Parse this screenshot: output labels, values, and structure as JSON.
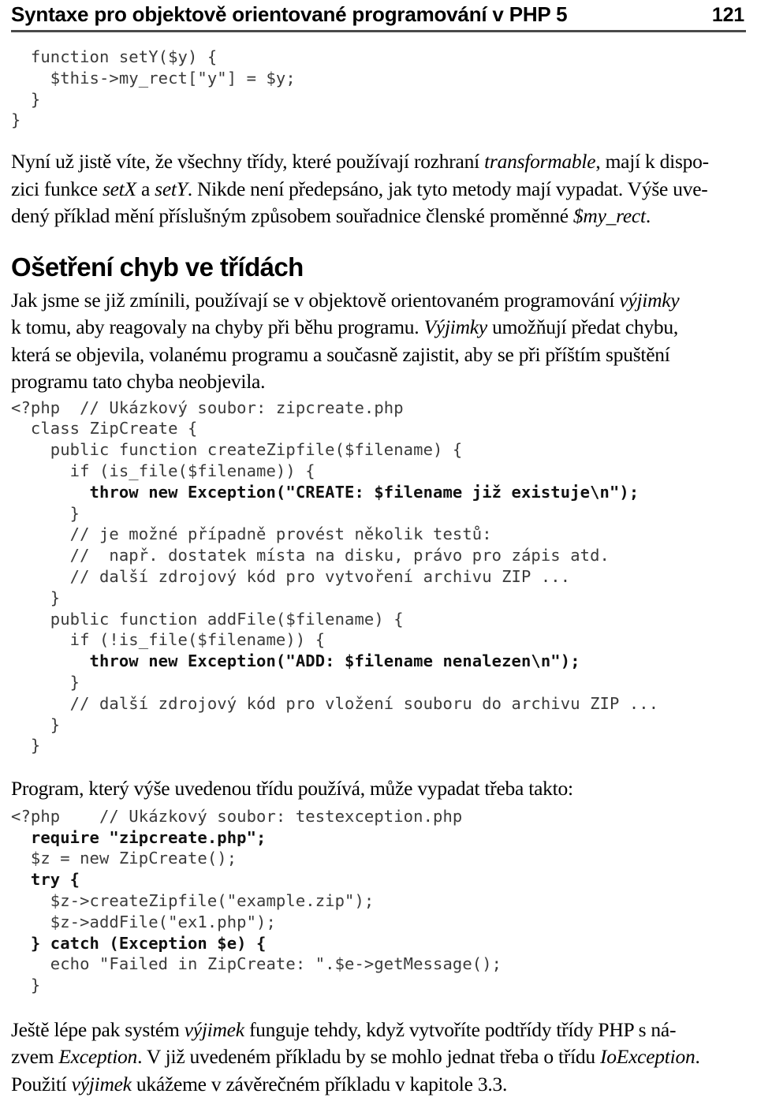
{
  "running_head": {
    "title": "Syntaxe pro objektově orientované programování v PHP 5",
    "page_number": "121"
  },
  "code_block_top": {
    "name": "setY method fragment",
    "lines": [
      "  function setY($y) {",
      "    $this->my_rect[\"y\"] = $y;",
      "  }",
      "}"
    ]
  },
  "paragraph_after_code1": {
    "lines": [
      {
        "parts": [
          {
            "t": "Nyní už jistě víte, že všechny třídy, které používají rozhraní ",
            "style": "normal"
          },
          {
            "t": "transformable",
            "style": "italic"
          },
          {
            "t": ", mají k dispo-",
            "style": "normal"
          }
        ]
      },
      {
        "parts": [
          {
            "t": "zici funkce ",
            "style": "normal"
          },
          {
            "t": "setX",
            "style": "italic"
          },
          {
            "t": " a ",
            "style": "normal"
          },
          {
            "t": "setY",
            "style": "italic"
          },
          {
            "t": ". Nikde není předepsáno, jak tyto metody mají vypadat. Výše uve-",
            "style": "normal"
          }
        ]
      },
      {
        "parts": [
          {
            "t": "dený příklad mění příslušným způsobem souřadnice členské proměnné ",
            "style": "normal"
          },
          {
            "t": "$my_rect",
            "style": "italic"
          },
          {
            "t": ".",
            "style": "normal"
          }
        ]
      }
    ]
  },
  "section_heading": "Ošetření chyb ve třídách",
  "paragraph_intro": {
    "lines": [
      {
        "parts": [
          {
            "t": "Jak jsme se již zmínili, používají se v objektově orientovaném programování ",
            "style": "normal"
          },
          {
            "t": "výjimky",
            "style": "italic"
          }
        ]
      },
      {
        "parts": [
          {
            "t": "k tomu, aby reagovaly na chyby při běhu programu. ",
            "style": "normal"
          },
          {
            "t": "Výjimky",
            "style": "italic"
          },
          {
            "t": " umožňují předat chybu,",
            "style": "normal"
          }
        ]
      },
      {
        "parts": [
          {
            "t": "která se objevila, volanému programu a současně zajistit, aby se při příštím spuštění",
            "style": "normal"
          }
        ]
      },
      {
        "parts": [
          {
            "t": "programu tato chyba neobjevila.",
            "style": "normal"
          }
        ]
      }
    ]
  },
  "code_block_zipcreate": {
    "name": "zipcreate.php",
    "lines": [
      {
        "segments": [
          {
            "t": "<?php  // Ukázkový soubor: zipcreate.php",
            "bold": false
          }
        ]
      },
      {
        "segments": [
          {
            "t": "  class ZipCreate {",
            "bold": false
          }
        ]
      },
      {
        "segments": [
          {
            "t": "    public function createZipfile($filename) {",
            "bold": false
          }
        ]
      },
      {
        "segments": [
          {
            "t": "      if (is_file($filename)) {",
            "bold": false
          }
        ]
      },
      {
        "segments": [
          {
            "t": "        throw new Exception(\"CREATE: $filename již existuje\\n\");",
            "bold": true
          }
        ]
      },
      {
        "segments": [
          {
            "t": "      }",
            "bold": false
          }
        ]
      },
      {
        "segments": [
          {
            "t": "      // je možné případně provést několik testů:",
            "bold": false
          }
        ]
      },
      {
        "segments": [
          {
            "t": "      //  např. dostatek místa na disku, právo pro zápis atd.",
            "bold": false
          }
        ]
      },
      {
        "segments": [
          {
            "t": "      // další zdrojový kód pro vytvoření archivu ZIP ...",
            "bold": false
          }
        ]
      },
      {
        "segments": [
          {
            "t": "    }",
            "bold": false
          }
        ]
      },
      {
        "segments": [
          {
            "t": "    public function addFile($filename) {",
            "bold": false
          }
        ]
      },
      {
        "segments": [
          {
            "t": "      if (!is_file($filename)) {",
            "bold": false
          }
        ]
      },
      {
        "segments": [
          {
            "t": "        throw new Exception(\"ADD: $filename nenalezen\\n\");",
            "bold": true
          }
        ]
      },
      {
        "segments": [
          {
            "t": "      }",
            "bold": false
          }
        ]
      },
      {
        "segments": [
          {
            "t": "      // další zdrojový kód pro vložení souboru do archivu ZIP ...",
            "bold": false
          }
        ]
      },
      {
        "segments": [
          {
            "t": "    }",
            "bold": false
          }
        ]
      },
      {
        "segments": [
          {
            "t": "  }",
            "bold": false
          }
        ]
      }
    ]
  },
  "paragraph_program": {
    "lines": [
      {
        "parts": [
          {
            "t": "Program, který výše uvedenou třídu používá, může vypadat třeba takto:",
            "style": "normal"
          }
        ]
      }
    ]
  },
  "code_block_testexception": {
    "name": "testexception.php",
    "lines": [
      {
        "segments": [
          {
            "t": "<?php    // Ukázkový soubor: testexception.php",
            "bold": false
          }
        ]
      },
      {
        "segments": [
          {
            "t": "  require \"zipcreate.php\";",
            "bold": true
          }
        ]
      },
      {
        "segments": [
          {
            "t": "  $z = new ZipCreate();",
            "bold": false
          }
        ]
      },
      {
        "segments": [
          {
            "t": "  try {",
            "bold": true
          }
        ]
      },
      {
        "segments": [
          {
            "t": "    $z->createZipfile(\"example.zip\");",
            "bold": false
          }
        ]
      },
      {
        "segments": [
          {
            "t": "    $z->addFile(\"ex1.php\");",
            "bold": false
          }
        ]
      },
      {
        "segments": [
          {
            "t": "  } catch (Exception $e) {",
            "bold": true
          }
        ]
      },
      {
        "segments": [
          {
            "t": "    echo \"Failed in ZipCreate: \".$e->getMessage();",
            "bold": false
          }
        ]
      },
      {
        "segments": [
          {
            "t": "  }",
            "bold": false
          }
        ]
      }
    ]
  },
  "paragraph_final": {
    "lines": [
      {
        "parts": [
          {
            "t": "Ještě lépe pak systém ",
            "style": "normal"
          },
          {
            "t": "výjimek",
            "style": "italic"
          },
          {
            "t": " funguje tehdy, když vytvoříte podtřídy třídy PHP s ná-",
            "style": "normal"
          }
        ]
      },
      {
        "parts": [
          {
            "t": "zvem ",
            "style": "normal"
          },
          {
            "t": "Exception",
            "style": "italic"
          },
          {
            "t": ". V již uvedeném příkladu by se mohlo jednat třeba o třídu ",
            "style": "normal"
          },
          {
            "t": "IoException",
            "style": "italic"
          },
          {
            "t": ".",
            "style": "normal"
          }
        ]
      },
      {
        "parts": [
          {
            "t": "Použití ",
            "style": "normal"
          },
          {
            "t": "výjimek",
            "style": "italic"
          },
          {
            "t": " ukážeme v závěrečném příkladu v kapitole 3.3.",
            "style": "normal"
          }
        ]
      }
    ]
  }
}
